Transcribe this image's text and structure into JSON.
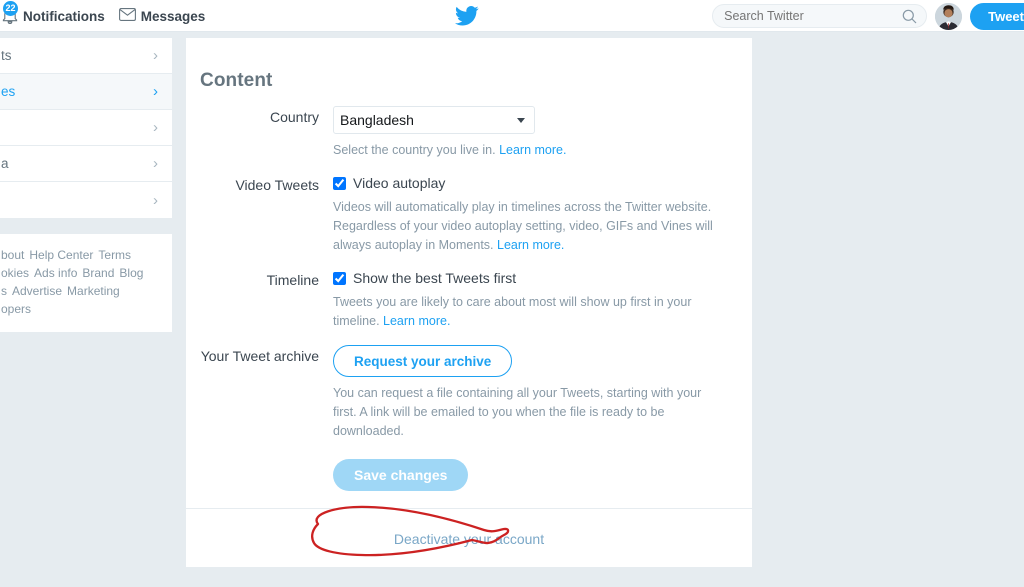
{
  "topnav": {
    "notifications": {
      "label": "Notifications",
      "badge": "22",
      "icon": "bell-icon"
    },
    "messages": {
      "label": "Messages",
      "icon": "envelope-icon"
    },
    "logo": "twitter-bird-logo",
    "search": {
      "placeholder": "Search Twitter",
      "value": "",
      "icon": "search-icon"
    },
    "avatar": "user-avatar",
    "tweet_button": "Tweet"
  },
  "sidebar": {
    "items": [
      {
        "label": "ts",
        "active": false
      },
      {
        "label": "es",
        "active": true
      },
      {
        "label": "",
        "active": false
      },
      {
        "label": "a",
        "active": false
      },
      {
        "label": "",
        "active": false
      }
    ],
    "chevron": "›",
    "footer_links": [
      "bout",
      "Help Center",
      "Terms",
      "okies",
      "Ads info",
      "Brand",
      "Blog",
      "s",
      "Advertise",
      "Marketing",
      "opers"
    ]
  },
  "main": {
    "heading": "Content",
    "country": {
      "label": "Country",
      "value": "Bangladesh",
      "options": [
        "Bangladesh"
      ],
      "hint_text": "Select the country you live in.",
      "hint_link": "Learn more."
    },
    "video_tweets": {
      "label": "Video Tweets",
      "checkbox_label": "Video autoplay",
      "checked": true,
      "hint_line1": "Videos will automatically play in timelines across the Twitter website.",
      "hint_line2": "Regardless of your video autoplay setting, video, GIFs and Vines will always",
      "hint_line3": "autoplay in Moments.",
      "hint_link": "Learn more."
    },
    "timeline": {
      "label": "Timeline",
      "checkbox_label": "Show the best Tweets first",
      "checked": true,
      "hint_line1": "Tweets you are likely to care about most will show up first in your timeline.",
      "hint_link": "Learn more."
    },
    "archive": {
      "label": "Your Tweet archive",
      "button_label": "Request your archive",
      "hint_line1": "You can request a file containing all your Tweets, starting with your first. A",
      "hint_line2": "link will be emailed to you when the file is ready to be downloaded."
    },
    "save_button": "Save changes",
    "deactivate_link": "Deactivate your account"
  },
  "annotation": {
    "type": "hand-drawn-red-circle",
    "color": "#cc2222",
    "target": "Deactivate your account"
  },
  "colors": {
    "twitter_blue": "#1da1f2",
    "page_bg": "#e6ecf0",
    "panel_bg": "#ffffff",
    "border": "#e6ecf0",
    "muted_text": "#8899a6",
    "annotation_red": "#cc2222"
  }
}
